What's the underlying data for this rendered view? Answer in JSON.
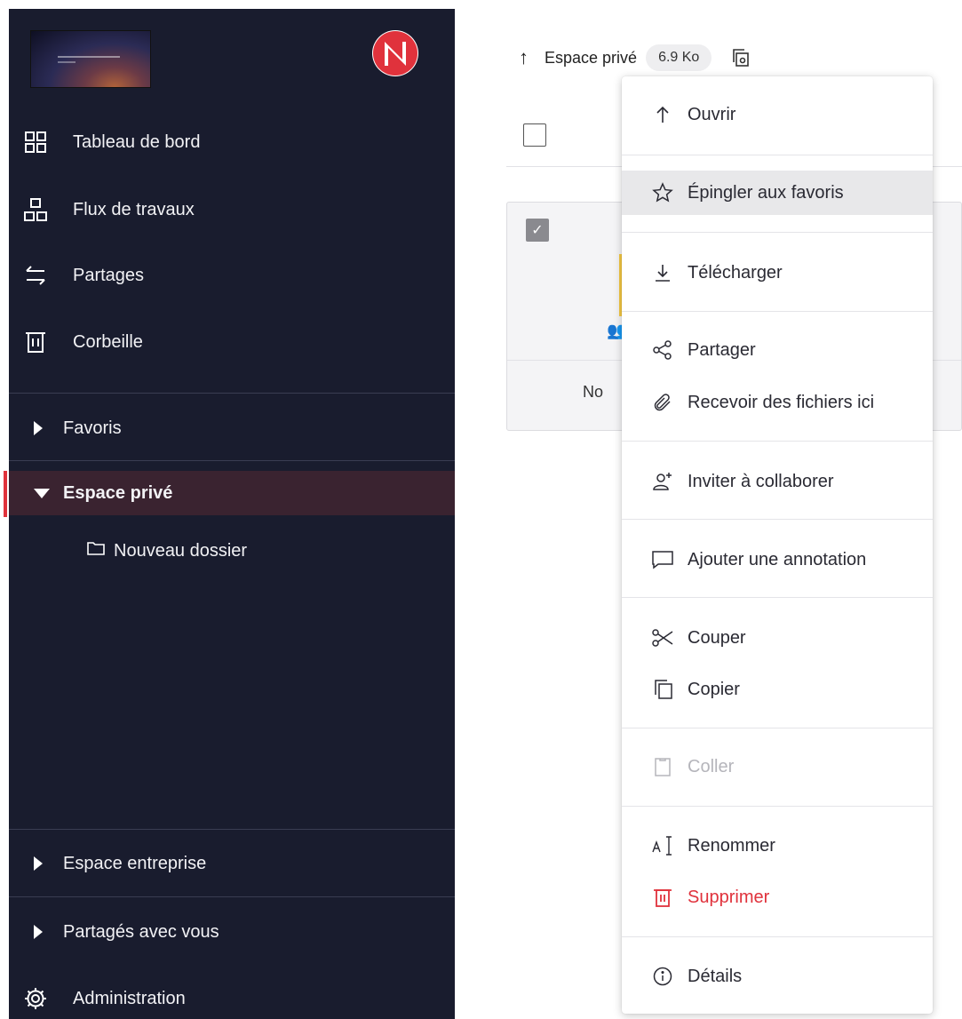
{
  "sidebar": {
    "nav": [
      {
        "label": "Tableau de bord",
        "icon": "grid-icon"
      },
      {
        "label": "Flux de travaux",
        "icon": "workflow-icon"
      },
      {
        "label": "Partages",
        "icon": "transfer-arrows-icon"
      },
      {
        "label": "Corbeille",
        "icon": "trash-icon"
      }
    ],
    "tree": {
      "favoris": "Favoris",
      "espace_prive": "Espace privé",
      "nouveau_dossier": "Nouveau dossier",
      "espace_entreprise": "Espace entreprise",
      "partages_avec_vous": "Partagés avec vous"
    },
    "admin": "Administration",
    "active_color": "#e0323c",
    "bg_color": "#191c2e"
  },
  "topbar": {
    "breadcrumb": "Espace privé",
    "size_badge": "6.9 Ko"
  },
  "card": {
    "name_partial": "No",
    "checkmark": "✓"
  },
  "menu": {
    "items": [
      {
        "label": "Ouvrir",
        "icon": "arrow-up-icon"
      },
      {
        "label": "Épingler aux favoris",
        "icon": "star-icon"
      },
      {
        "label": "Télécharger",
        "icon": "download-icon"
      },
      {
        "label": "Partager",
        "icon": "share-icon"
      },
      {
        "label": "Recevoir des fichiers ici",
        "icon": "paperclip-icon"
      },
      {
        "label": "Inviter à collaborer",
        "icon": "add-user-icon"
      },
      {
        "label": "Ajouter une annotation",
        "icon": "comment-icon"
      },
      {
        "label": "Couper",
        "icon": "scissors-icon"
      },
      {
        "label": "Copier",
        "icon": "copy-icon"
      },
      {
        "label": "Coller",
        "icon": "clipboard-icon"
      },
      {
        "label": "Renommer",
        "icon": "rename-icon"
      },
      {
        "label": "Supprimer",
        "icon": "trash-icon"
      },
      {
        "label": "Détails",
        "icon": "info-icon"
      }
    ],
    "danger_color": "#e0323c"
  }
}
